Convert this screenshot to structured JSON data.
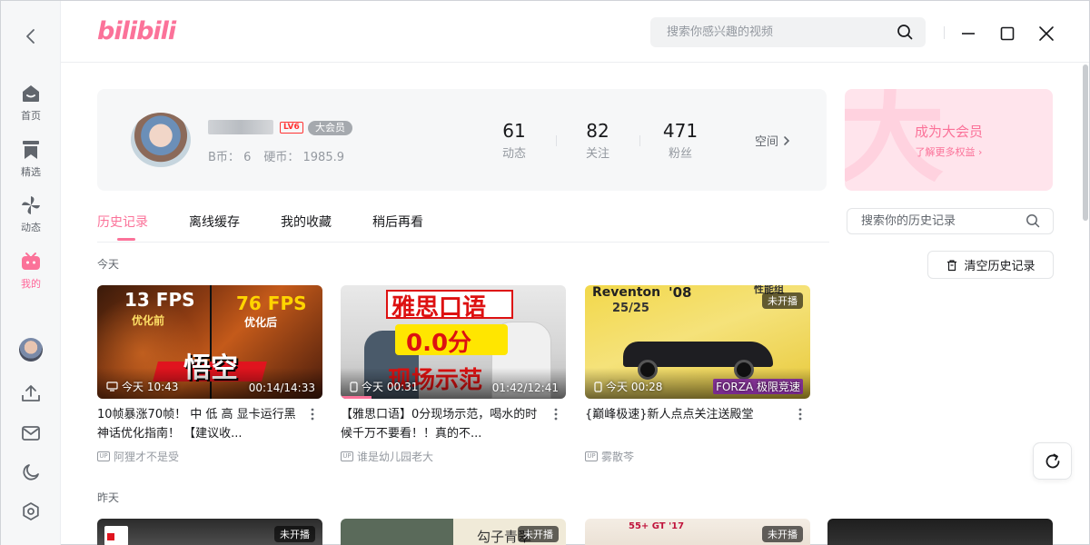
{
  "sidebar": {
    "items": [
      {
        "label": "首页"
      },
      {
        "label": "精选"
      },
      {
        "label": "动态"
      },
      {
        "label": "我的"
      }
    ]
  },
  "header": {
    "logo": "bilibili",
    "search_placeholder": "搜索你感兴趣的视频"
  },
  "profile": {
    "level": "LV6",
    "vip_tag": "大会员",
    "b_coin_label": "B币：",
    "b_coin": "6",
    "coin_label": "硬币：",
    "coin": "1985.9",
    "stats": [
      {
        "value": "61",
        "label": "动态"
      },
      {
        "value": "82",
        "label": "关注"
      },
      {
        "value": "471",
        "label": "粉丝"
      }
    ],
    "space_link": "空间"
  },
  "vip_card": {
    "title": "成为大会员",
    "subtitle": "了解更多权益"
  },
  "tabs": [
    {
      "label": "历史记录",
      "active": true
    },
    {
      "label": "离线缓存"
    },
    {
      "label": "我的收藏"
    },
    {
      "label": "稍后再看"
    }
  ],
  "history_search_placeholder": "搜索你的历史记录",
  "clear_history": "清空历史记录",
  "sections": {
    "today": "今天",
    "yesterday": "昨天"
  },
  "videos_today": [
    {
      "thumb_top_left": "13 FPS",
      "thumb_top_left_sub": "优化前",
      "thumb_top_right": "76 FPS",
      "thumb_top_right_sub": "优化后",
      "thumb_center": "悟空",
      "watched": "今天 10:43",
      "progress": "00:14/14:33",
      "title": "10帧暴涨70帧！ 中 低 高 显卡运行黑神话优化指南！ 【建议收...",
      "uploader": "阿狸才不是受"
    },
    {
      "thumb_top": "雅思口语",
      "thumb_mid": "0.0分",
      "thumb_bottom": "现场示范",
      "watched": "今天 00:31",
      "progress": "01:42/12:41",
      "title": "【雅思口语】0分现场示范，喝水的时候千万不要看！！真的不...",
      "uploader": "谁是幼儿园老大"
    },
    {
      "thumb_car": "Reventon",
      "thumb_year": "'08",
      "thumb_rank": "25/25",
      "thumb_corner": "性能组",
      "badge": "未开播",
      "watched": "今天 00:28",
      "thumb_br": "FORZA 极限竞速",
      "title": "{巅峰极速}新人点点关注送殿堂",
      "uploader": "雾散芩"
    }
  ],
  "videos_yesterday": [
    {
      "badge": "未开播"
    },
    {
      "badge": "未开播",
      "thumb_text": "勾子青翠"
    },
    {
      "badge": "未开播",
      "thumb_text": "55+ GT '17"
    },
    {}
  ],
  "colors": {
    "accent": "#fb7299",
    "sidebar_bg": "#f6f7f8",
    "text_secondary": "#9499a0"
  }
}
